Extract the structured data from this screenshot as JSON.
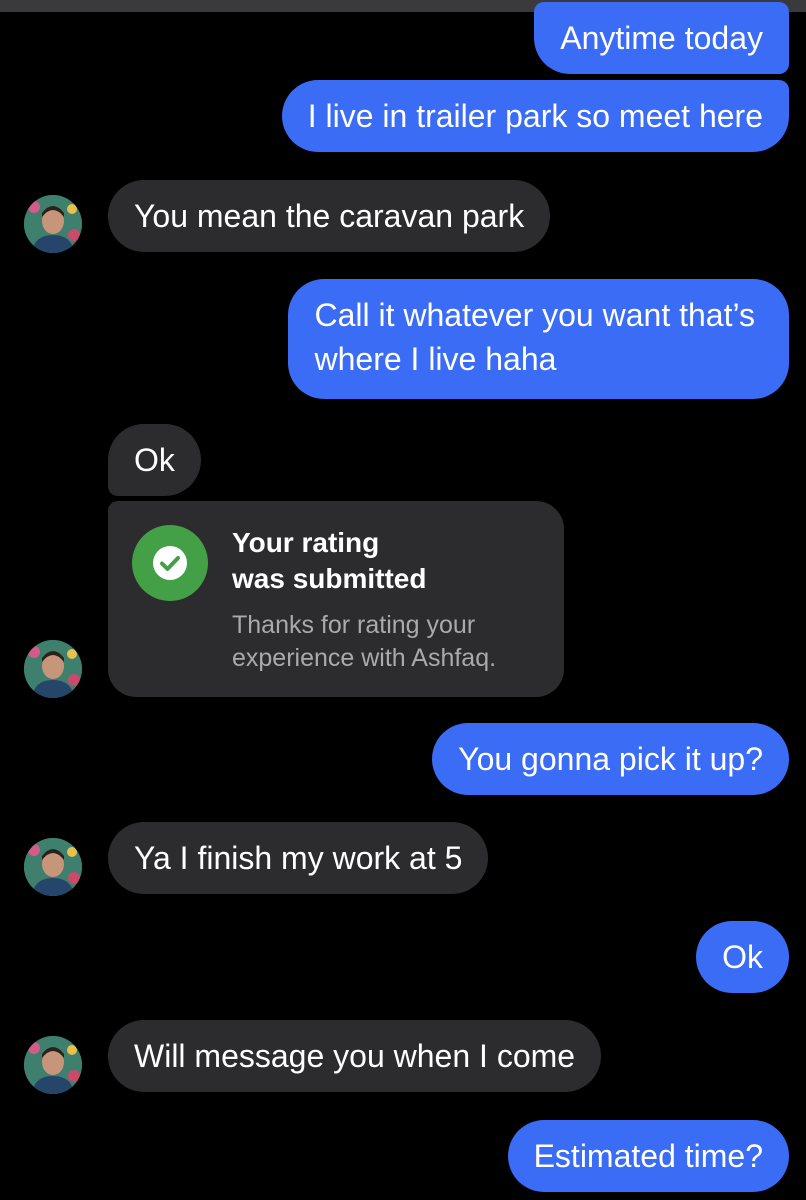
{
  "messages": [
    {
      "side": "out",
      "text": "Anytime today"
    },
    {
      "side": "out",
      "text": "I live in trailer park so meet here"
    },
    {
      "side": "in",
      "text": "You mean the caravan park"
    },
    {
      "side": "out",
      "text": "Call it whatever you want that’s\nwhere I live haha"
    },
    {
      "side": "in",
      "text": "Ok"
    },
    {
      "side": "out",
      "text": "You gonna pick it up?"
    },
    {
      "side": "in",
      "text": "Ya I finish my work at 5"
    },
    {
      "side": "out",
      "text": "Ok"
    },
    {
      "side": "in",
      "text": "Will message you when I come"
    },
    {
      "side": "out",
      "text": "Estimated time?"
    }
  ],
  "rating_card": {
    "title": "Your rating\nwas submitted",
    "subtitle": "Thanks for rating your\nexperience with Ashfaq.",
    "icon": "check-circle-icon"
  },
  "colors": {
    "outgoing_bubble": "#3b6cf6",
    "incoming_bubble": "#2c2c2e",
    "background": "#000000",
    "check": "#43a047"
  }
}
